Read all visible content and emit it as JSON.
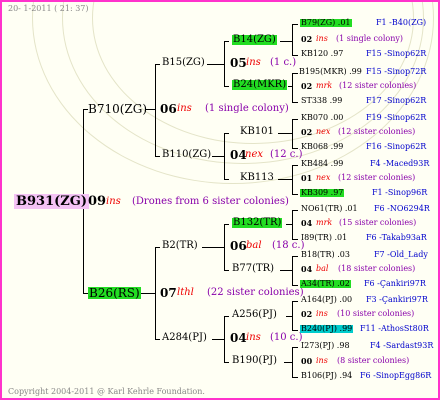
{
  "header": {
    "date": "20-  1-2011 ( 21: 37)"
  },
  "footer": {
    "copyright": "Copyright 2004-2011 @ Karl Kehrle Foundation."
  },
  "root": {
    "id": "B931(ZG)",
    "year": "09",
    "code": "ins",
    "note": "(Drones from 6 sister colonies)"
  },
  "gen1": [
    {
      "id": "B710(ZG)",
      "year": "06",
      "code": "ins",
      "note": "(1 single colony)"
    },
    {
      "id": "B26(RS)",
      "year": "07",
      "code": "lthl",
      "note": "(22 sister colonies)"
    }
  ],
  "gen2": [
    {
      "id": "B15(ZG)",
      "year": "05",
      "code": "ins",
      "note": "(1 c.)"
    },
    {
      "id": "B110(ZG)",
      "year": "04",
      "code": "nex",
      "note": "(12 c.)"
    },
    {
      "id": "B2(TR)",
      "year": "06",
      "code": "bal",
      "note": "(18 c.)"
    },
    {
      "id": "A284(PJ)",
      "year": "04",
      "code": "ins",
      "note": "(10 c.)"
    }
  ],
  "gen3": [
    {
      "id": "B14(ZG)"
    },
    {
      "id": "B24(MKR)"
    },
    {
      "id": "KB101"
    },
    {
      "id": "KB113"
    },
    {
      "id": "B132(TR)"
    },
    {
      "id": "B77(TR)"
    },
    {
      "id": "A256(PJ)"
    },
    {
      "id": "B190(PJ)"
    }
  ],
  "gen4": [
    {
      "id": "B79(ZG) .01",
      "ref": "F1 -B40(ZG)"
    },
    {
      "year": "02",
      "code": "ins",
      "note": "(1 single colony)"
    },
    {
      "id": "KB120 .97",
      "ref": "F15 -Sinop62R"
    },
    {
      "id": "B195(MKR) .99",
      "ref": "F15 -Sinop72R"
    },
    {
      "year": "02",
      "code": "mrk",
      "note": "(12 sister colonies)"
    },
    {
      "id": "ST338 .99",
      "ref": "F17 -Sinop62R"
    },
    {
      "id": "KB070 .00",
      "ref": "F19 -Sinop62R"
    },
    {
      "year": "02",
      "code": "nex",
      "note": "(12 sister colonies)"
    },
    {
      "id": "KB068 .99",
      "ref": "F16 -Sinop62R"
    },
    {
      "id": "KB484 .99",
      "ref": "F4 -Maced93R"
    },
    {
      "year": "01",
      "code": "nex",
      "note": "(12 sister colonies)"
    },
    {
      "id": "KB309 .97",
      "ref": "F1 -Sinop96R"
    },
    {
      "id": "NO61(TR) .01",
      "ref": "F6 -NO6294R"
    },
    {
      "year": "04",
      "code": "mrk",
      "note": "(15 sister colonies)"
    },
    {
      "id": "I89(TR) .01",
      "ref": "F6 -Takab93aR"
    },
    {
      "id": "B18(TR) .03",
      "ref": "F7 -Old_Lady"
    },
    {
      "year": "04",
      "code": "bal",
      "note": "(18 sister colonies)"
    },
    {
      "id": "A34(TR) .02",
      "ref": "F6 -Çankiri97R"
    },
    {
      "id": "A164(PJ) .00",
      "ref": "F3 -Çankiri97R"
    },
    {
      "year": "02",
      "code": "ins",
      "note": "(10 sister colonies)"
    },
    {
      "id": "B240(PJ) .99",
      "ref": "F11 -AthosSt80R"
    },
    {
      "id": "I273(PJ) .98",
      "ref": "F4 -Sardast93R"
    },
    {
      "year": "00",
      "code": "ins",
      "note": "(8 sister colonies)"
    },
    {
      "id": "B106(PJ) .94",
      "ref": "F6 -SinopEgg86R"
    }
  ]
}
